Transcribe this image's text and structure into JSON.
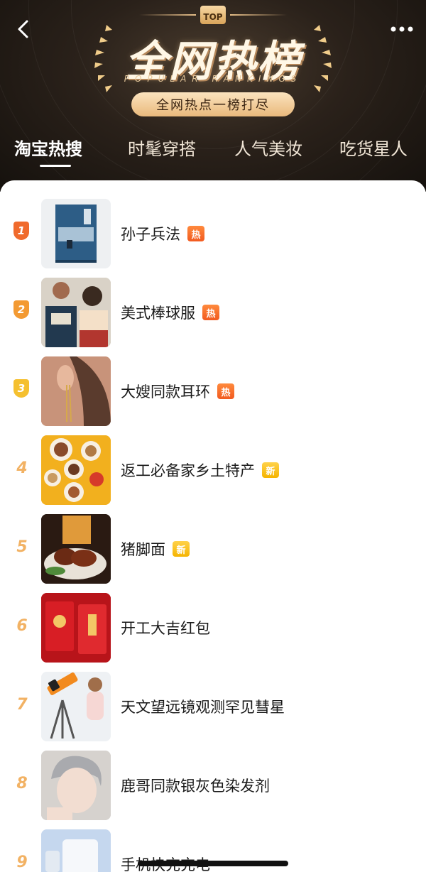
{
  "header": {
    "badge": "TOP",
    "title": "全网热榜",
    "subtitle": "POPULAR RANKINGS",
    "slogan": "全网热点一榜打尽",
    "back_icon": "chevron-left-icon",
    "more_icon": "more-dots-icon"
  },
  "tabs": [
    {
      "label": "淘宝热搜",
      "active": true
    },
    {
      "label": "时髦穿搭",
      "active": false
    },
    {
      "label": "人气美妆",
      "active": false
    },
    {
      "label": "吃货星人",
      "active": false
    }
  ],
  "items": [
    {
      "rank": "1",
      "title": "孙子兵法",
      "tag": "热",
      "tag_type": "hot"
    },
    {
      "rank": "2",
      "title": "美式棒球服",
      "tag": "热",
      "tag_type": "hot"
    },
    {
      "rank": "3",
      "title": "大嫂同款耳环",
      "tag": "热",
      "tag_type": "hot"
    },
    {
      "rank": "4",
      "title": "返工必备家乡土特产",
      "tag": "新",
      "tag_type": "new"
    },
    {
      "rank": "5",
      "title": "猪脚面",
      "tag": "新",
      "tag_type": "new"
    },
    {
      "rank": "6",
      "title": "开工大吉红包",
      "tag": "",
      "tag_type": ""
    },
    {
      "rank": "7",
      "title": "天文望远镜观测罕见彗星",
      "tag": "",
      "tag_type": ""
    },
    {
      "rank": "8",
      "title": "鹿哥同款银灰色染发剂",
      "tag": "",
      "tag_type": ""
    },
    {
      "rank": "9",
      "title": "手机快充充电",
      "tag": "",
      "tag_type": ""
    }
  ],
  "colors": {
    "rank1": "#f06a2c",
    "rank2": "#f39a33",
    "rank3": "#f5c02f",
    "rank_other": "#f2b264",
    "header_bg": "#2a211a",
    "tag_hot": "#f25a20",
    "tag_new": "#f5b400"
  }
}
